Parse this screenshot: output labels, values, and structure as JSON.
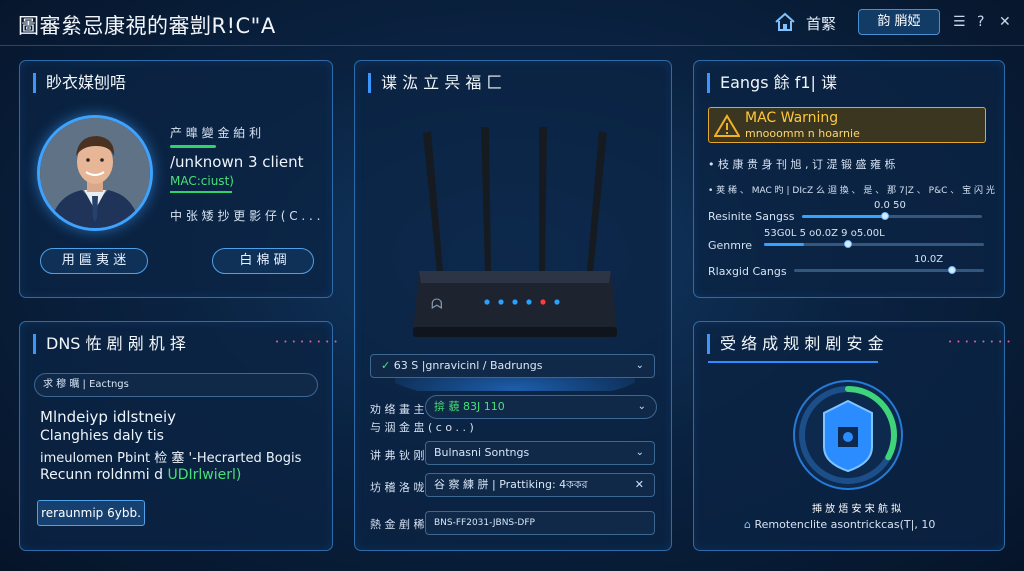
{
  "topbar": {
    "app_title": "圖審絫忌康視的審剴R!C\"A",
    "home_icon": "home-icon",
    "nav_label": "首緊",
    "action_button": "韵 䏴婭",
    "menu_icon": "menu-icon",
    "help_icon": "help-icon",
    "close_icon": "close-icon"
  },
  "client_panel": {
    "title": "眇衣媒刨唔",
    "status_line": "产 曍 變 金 絈 利",
    "client_name": "/unknown 3 client",
    "mac_label": "MAC:ciust)",
    "note_line": "中 张 矮 抄 更 影 仔 ( C . . .",
    "button_left": "用 匾 夷 迷",
    "button_right": "白 棉 碉"
  },
  "router_panel": {
    "title": "谍 汯 立 昗 福 匚",
    "lights": [
      {
        "state": "on",
        "color": "#2aa0ff"
      },
      {
        "state": "on",
        "color": "#2aa0ff"
      },
      {
        "state": "on",
        "color": "#2aa0ff"
      },
      {
        "state": "on",
        "color": "#2aa0ff"
      },
      {
        "state": "on",
        "color": "#ff3b3b"
      },
      {
        "state": "on",
        "color": "#2aa0ff"
      }
    ],
    "rows": [
      {
        "label": "",
        "value": "63 S |gnravicinl / Badrungs",
        "icon": "check-icon",
        "control": "dropdown"
      },
      {
        "label": "劝 络 畫 主",
        "value": "揜 藐   83J 110",
        "control": "dropdown-round"
      },
      {
        "label": "与 洇 金 盅 ( c o . . )",
        "value": "",
        "control": "none"
      },
      {
        "label": "讲 弗 钬 刚",
        "value": "Bulnasni Sontngs",
        "control": "dropdown"
      },
      {
        "label": "坊 稽 洛 咙",
        "value": "谷 察 練 胼 | Prattiking: 4ক‍কর",
        "control": "clear"
      },
      {
        "label": "熱 金 剷 稀",
        "value": "BNS-FF2031-JBNS-DFP",
        "control": "text"
      }
    ]
  },
  "warning_panel": {
    "title": "Eangs 餘 f1| 谍",
    "warning_title": "MAC Warning",
    "warning_subtitle": "mnooomm n hoarnie",
    "bullet_1": "• 枝 康 贵 身 刊 旭 , 订 湜 锻 盛 雍 栎",
    "bullet_2": "• 荚 稀 、 MAC 旳 |   DIcZ 么 迴 換 、 是 、 那 7|Z 、 P&C 、 宝 闪 光",
    "sliders": [
      {
        "label": "Resinite Sangss",
        "readout": "0.0  50",
        "fill": 0.46,
        "knob": 0.46
      },
      {
        "label": "Genmre",
        "readout": "53G0L   5   o0.0Z   9   o5.00L",
        "fill": 0.18,
        "knob": 0.38
      },
      {
        "label": "Rlaxgid Cangs",
        "readout": "10.0Z",
        "fill": 0.0,
        "knob": 0.83
      }
    ]
  },
  "dns_panel": {
    "title": "DNS 恠 剧 剐 机 择",
    "dots": "• • • • • • • •",
    "filter_value": "求 穆 曞 | Eactngs",
    "lines": [
      "Mlndeiyp idlstneiy",
      "Clanghies daly tis",
      "imeulomen Pbint 检 塞 '-Hecrarted Bogis",
      "Recunn roldnmi d"
    ],
    "highlight": "UDIrlwierl)",
    "button": "reraunmip 6ybb."
  },
  "security_panel": {
    "title": "受 络 成 规 刺 剧 安 金",
    "dots": "• • • • • • • •",
    "ring_fraction": 0.33,
    "caption": "揷 放 焐 安 宋 航 拟",
    "footer_text": "Remotenclite asontrickcas(T|,  10",
    "footer_icon": "home-icon"
  }
}
